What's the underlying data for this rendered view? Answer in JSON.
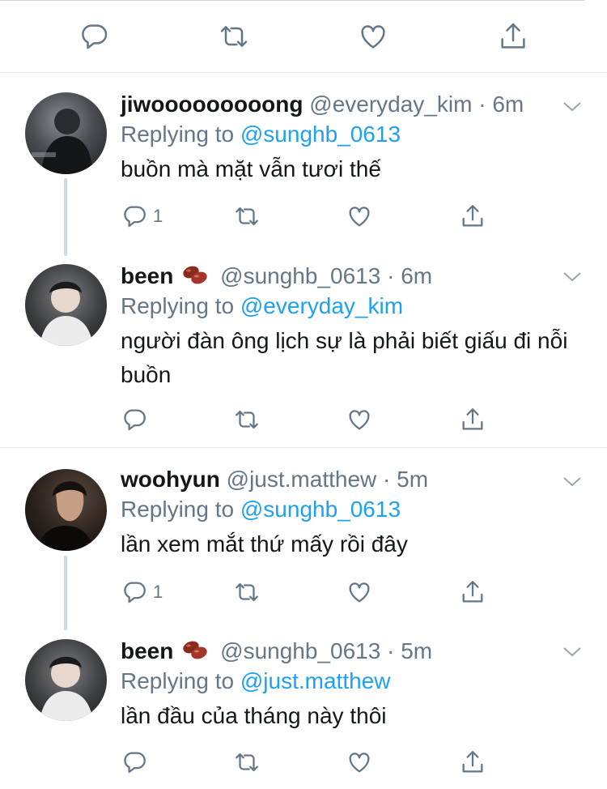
{
  "top_actions": [
    "reply-icon",
    "retweet-icon",
    "like-icon",
    "share-icon"
  ],
  "tweets": [
    {
      "name": "jiwooooooooong",
      "handle": "@everyday_kim",
      "time": "6m",
      "reply_label": "Replying to",
      "reply_to": "@sunghb_0613",
      "text": "buồn mà mặt vẫn tươi thế",
      "reply_count": "1"
    },
    {
      "name": "been",
      "emoji": "bean-emoji",
      "handle": "@sunghb_0613",
      "time": "6m",
      "reply_label": "Replying to",
      "reply_to": "@everyday_kim",
      "text": "người đàn ông lịch sự là phải biết giấu đi nỗi buồn",
      "reply_count": ""
    },
    {
      "name": "woohyun",
      "handle": "@just.matthew",
      "time": "5m",
      "reply_label": "Replying to",
      "reply_to": "@sunghb_0613",
      "text": "lần xem mắt thứ mấy rồi đây",
      "reply_count": "1"
    },
    {
      "name": "been",
      "emoji": "bean-emoji",
      "handle": "@sunghb_0613",
      "time": "5m",
      "reply_label": "Replying to",
      "reply_to": "@just.matthew",
      "text": "lần đầu của tháng này thôi",
      "reply_count": ""
    }
  ],
  "colors": {
    "link": "#1da1f2",
    "secondary": "#657786",
    "separator": "#e1e8ed"
  }
}
